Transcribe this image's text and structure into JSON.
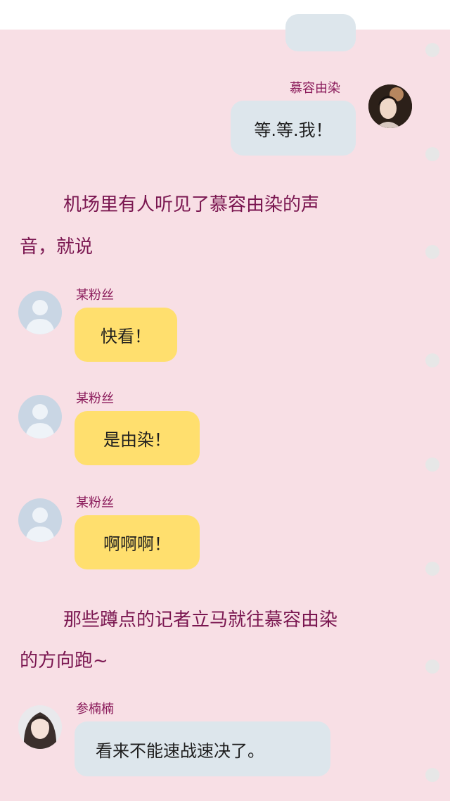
{
  "colors": {
    "background": "#f8dfe5",
    "bubble_blue": "#dde6ec",
    "bubble_yellow": "#ffdf6e",
    "name_text": "#8a1a5a",
    "narration_text": "#7a1650"
  },
  "messages": {
    "m1": {
      "sender": "慕容由染",
      "text": "等.等.我！"
    },
    "m2": {
      "sender": "某粉丝",
      "text": "快看！"
    },
    "m3": {
      "sender": "某粉丝",
      "text": "是由染！"
    },
    "m4": {
      "sender": "某粉丝",
      "text": "啊啊啊！"
    },
    "m5": {
      "sender": "参楠楠",
      "text": "看来不能速战速决了。"
    }
  },
  "narration": {
    "n1": {
      "line1": "机场里有人听见了慕容由染的声",
      "line2": "音，就说"
    },
    "n2": {
      "line1": "那些蹲点的记者立马就往慕容由染",
      "line2": "的方向跑~"
    }
  },
  "icons": {
    "avatar_generic": "person-silhouette",
    "avatar_photo": "user-photo",
    "scroll_dot": "circle"
  }
}
